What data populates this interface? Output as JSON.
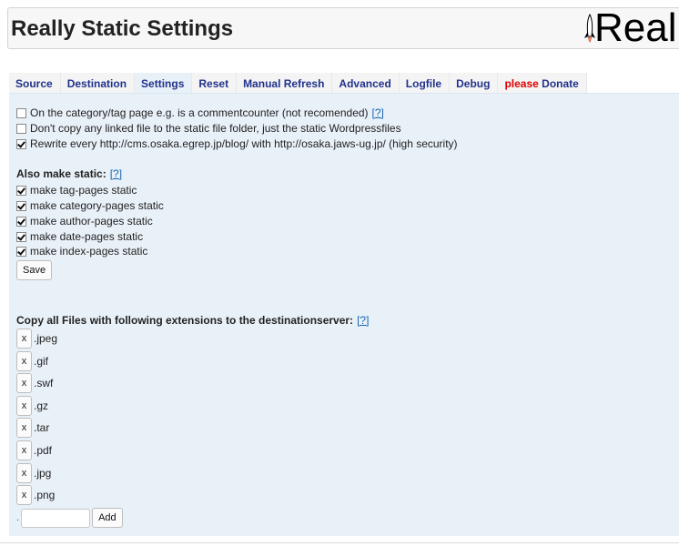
{
  "page": {
    "title": "Really Static Settings",
    "logo_text": "Real"
  },
  "tabs": [
    {
      "label": "Source"
    },
    {
      "label": "Destination"
    },
    {
      "label": "Settings",
      "active": true
    },
    {
      "label": "Reset"
    },
    {
      "label": "Manual Refresh"
    },
    {
      "label": "Advanced"
    },
    {
      "label": "Logfile"
    },
    {
      "label": "Debug"
    },
    {
      "label_red": "please",
      "label": "Donate"
    }
  ],
  "options": [
    {
      "label": "On the category/tag page e.g. is a commentcounter (not recomended)",
      "help": "[?]",
      "checked": false
    },
    {
      "label": "Don't copy any linked file to the static file folder, just the static Wordpressfiles",
      "help": "",
      "checked": false
    },
    {
      "label": "Rewrite every http://cms.osaka.egrep.jp/blog/ with http://osaka.jaws-ug.jp/ (high security)",
      "help": "",
      "checked": true
    }
  ],
  "static_section": {
    "heading": "Also make static:",
    "help": "[?]",
    "items": [
      {
        "label": "make tag-pages static",
        "checked": true
      },
      {
        "label": "make category-pages static",
        "checked": true
      },
      {
        "label": "make author-pages static",
        "checked": true
      },
      {
        "label": "make date-pages static",
        "checked": true
      },
      {
        "label": "make index-pages static",
        "checked": true
      }
    ],
    "save_label": "Save"
  },
  "extensions_section": {
    "heading": "Copy all Files with following extensions to the destinationserver:",
    "help": "[?]",
    "remove_label": "x",
    "items": [
      ".jpeg",
      ".gif",
      ".swf",
      ".gz",
      ".tar",
      ".pdf",
      ".jpg",
      ".png"
    ],
    "add_prefix": ".",
    "input_value": "",
    "add_label": "Add"
  },
  "colors": {
    "tab_text": "#21328b",
    "donate_red": "#e00000",
    "panel_bg": "#e9f1f8",
    "help_link": "#1a66b0"
  }
}
